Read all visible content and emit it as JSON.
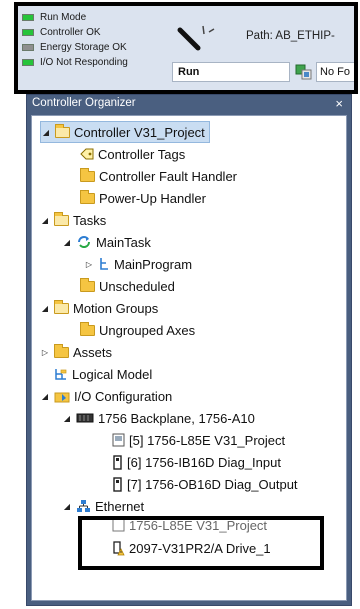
{
  "status_panel": {
    "items": [
      {
        "label": "Run Mode",
        "led": "green"
      },
      {
        "label": "Controller OK",
        "led": "green"
      },
      {
        "label": "Energy Storage OK",
        "led": "gray"
      },
      {
        "label": "I/O Not Responding",
        "led": "green"
      }
    ],
    "path_label": "Path: AB_ETHIP-",
    "mode_value": "Run",
    "fault_value": "No Fo"
  },
  "organizer": {
    "title": "Controller Organizer",
    "close_glyph": "×",
    "tree": [
      {
        "label": "Controller V31_Project",
        "selected": true
      },
      {
        "label": "Controller Tags"
      },
      {
        "label": "Controller Fault Handler"
      },
      {
        "label": "Power-Up Handler"
      },
      {
        "label": "Tasks"
      },
      {
        "label": "MainTask"
      },
      {
        "label": "MainProgram"
      },
      {
        "label": "Unscheduled"
      },
      {
        "label": "Motion Groups"
      },
      {
        "label": "Ungrouped Axes"
      },
      {
        "label": "Assets"
      },
      {
        "label": "Logical Model"
      },
      {
        "label": "I/O Configuration"
      },
      {
        "label": "1756 Backplane, 1756-A10"
      },
      {
        "label": "[5] 1756-L85E V31_Project"
      },
      {
        "label": "[6] 1756-IB16D Diag_Input"
      },
      {
        "label": "[7] 1756-OB16D Diag_Output"
      },
      {
        "label": "Ethernet"
      },
      {
        "label": "1756-L85E V31_Project"
      },
      {
        "label": "2097-V31PR2/A Drive_1"
      }
    ]
  },
  "colors": {
    "panel_header": "#4a5f80",
    "toolbar_bg": "#dbe3ef",
    "selection": "#c9ddf2",
    "led_green": "#26c43a",
    "folder": "#f5c542"
  }
}
